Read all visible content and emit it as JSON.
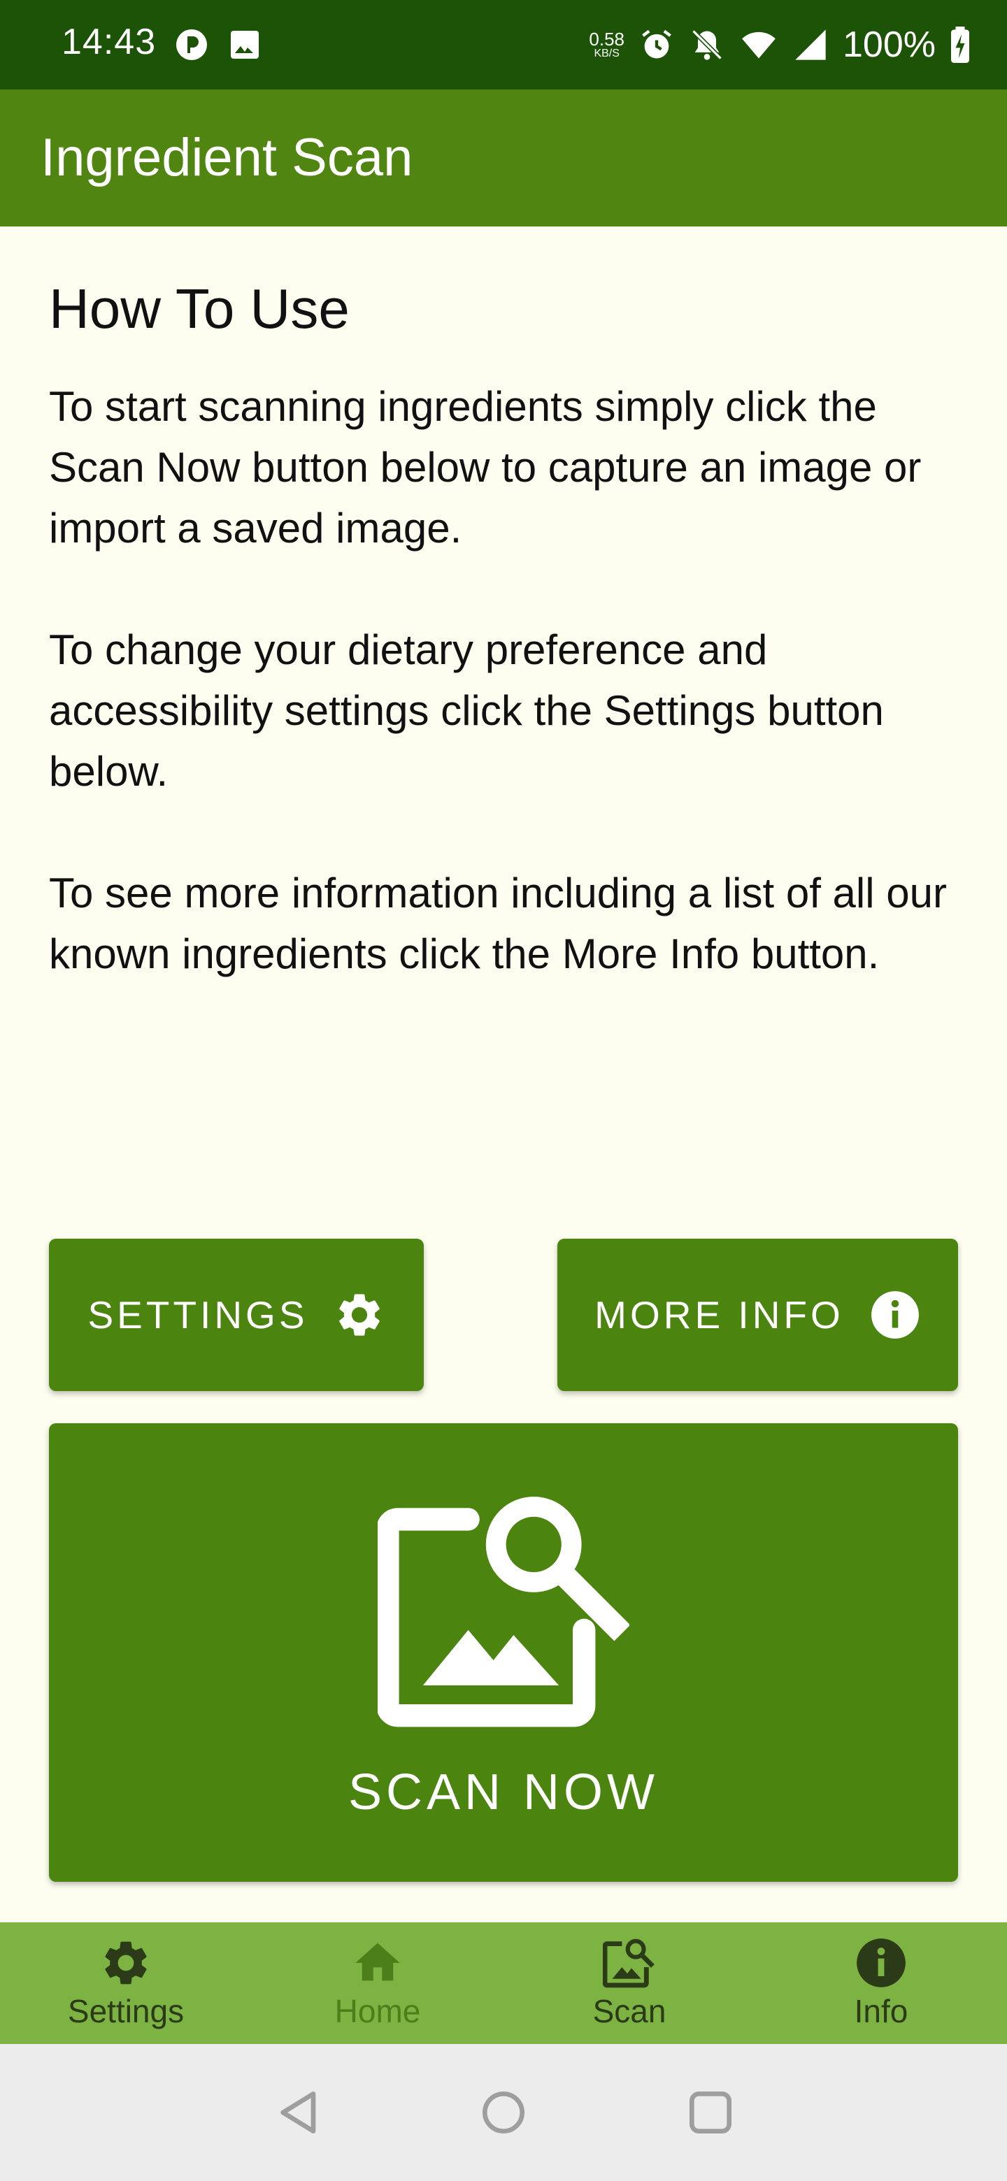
{
  "status_bar": {
    "time": "14:43",
    "net_speed_value": "0.58",
    "net_speed_unit": "KB/S",
    "battery": "100%"
  },
  "app_bar": {
    "title": "Ingredient Scan"
  },
  "content": {
    "heading": "How To Use",
    "paragraphs": [
      "To start scanning ingredients simply click the Scan Now button below to capture an image or import a saved image.",
      "To change your dietary preference and accessibility settings click the Settings button below.",
      "To see more information including a list of all our known ingredients click the More Info button."
    ]
  },
  "buttons": {
    "settings": "SETTINGS",
    "more_info": "MORE INFO",
    "scan_now": "SCAN NOW"
  },
  "bottom_nav": {
    "items": [
      {
        "label": "Settings",
        "icon": "gear-icon"
      },
      {
        "label": "Home",
        "icon": "home-icon",
        "active": true
      },
      {
        "label": "Scan",
        "icon": "image-search-icon"
      },
      {
        "label": "Info",
        "icon": "info-icon"
      }
    ]
  },
  "colors": {
    "status_bar": "#1c5307",
    "app_bar": "#4f8510",
    "background": "#fdfef0",
    "button": "#4b840e",
    "bottom_nav": "#7cb342",
    "system_nav": "#ececec"
  }
}
